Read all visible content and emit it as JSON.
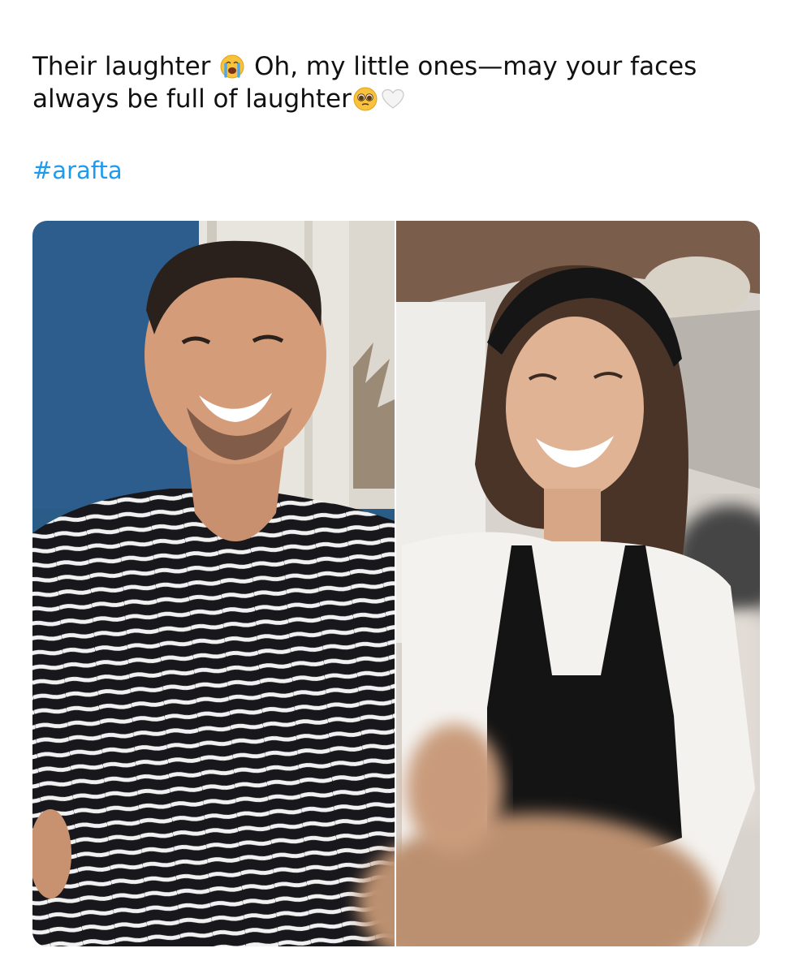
{
  "post": {
    "line1_part1": "Their laughter",
    "line1_part2": "Oh, my little ones—may your faces",
    "line2_part1": "always be full of laughter",
    "hashtag": "#arafta",
    "emojis": [
      "loudly-crying-face-icon",
      "pleading-face-icon",
      "white-heart-icon"
    ]
  },
  "media": {
    "layout": "two-photo-side-by-side",
    "left_photo": "man-laughing-striped-shirt",
    "right_photo": "woman-laughing-black-apron",
    "colors": {
      "left_background_blue": "#2b5b8a",
      "shirt_stripe_dark": "#15151a",
      "apron_black": "#141414",
      "right_background_warm": "#d8d2cc"
    }
  }
}
